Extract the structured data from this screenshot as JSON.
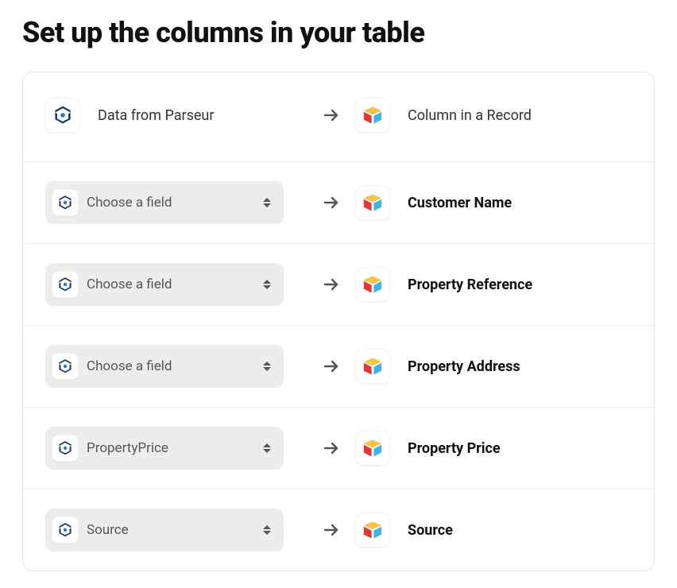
{
  "title": "Set up the columns in your table",
  "header": {
    "source_label": "Data from Parseur",
    "target_label": "Column in a Record"
  },
  "placeholder": "Choose a field",
  "mappings": [
    {
      "field": "",
      "target": "Customer Name"
    },
    {
      "field": "",
      "target": "Property Reference"
    },
    {
      "field": "",
      "target": "Property Address"
    },
    {
      "field": "PropertyPrice",
      "target": "Property Price"
    },
    {
      "field": "Source",
      "target": "Source"
    }
  ]
}
